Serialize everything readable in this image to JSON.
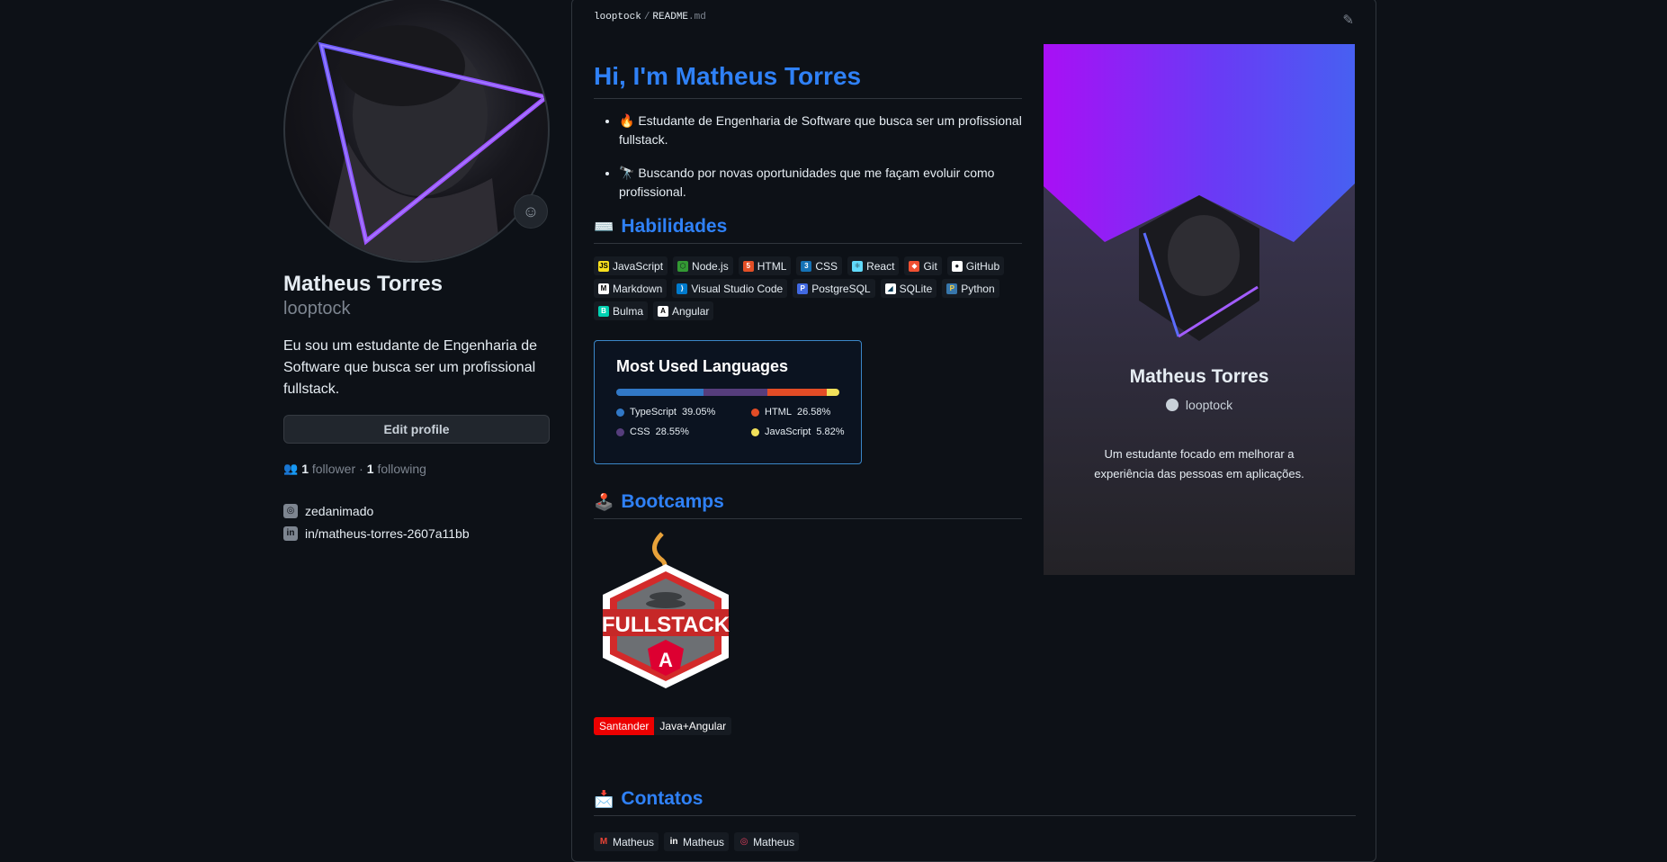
{
  "profile": {
    "name": "Matheus Torres",
    "login": "looptock",
    "bio": "Eu sou um estudante de Engenharia de Software que busca ser um profissional fullstack.",
    "edit_label": "Edit profile",
    "followers_count": "1",
    "followers_label": "follower",
    "dot": "·",
    "following_count": "1",
    "following_label": "following",
    "social": [
      {
        "icon": "instagram-icon",
        "text": "zedanimado"
      },
      {
        "icon": "linkedin-icon",
        "text": "in/matheus-torres-2607a11bb"
      }
    ]
  },
  "readme": {
    "breadcrumb_user": "looptock",
    "breadcrumb_sep": "/",
    "breadcrumb_file": "README",
    "breadcrumb_ext": ".md",
    "heading": "Hi, I'm Matheus Torres",
    "bullets": [
      {
        "emoji": "🔥",
        "text": "Estudante de Engenharia de Software que busca ser um profissional fullstack."
      },
      {
        "emoji": "🔭",
        "text": "Buscando por novas oportunidades que me façam evoluir como profissional."
      }
    ],
    "skills_emoji": "⌨️",
    "skills_title": "Habilidades",
    "skills": [
      {
        "label": "JavaScript",
        "icon": "javascript-icon",
        "color": "#f7df1e",
        "glyph": "JS",
        "fg": "#000"
      },
      {
        "label": "Node.js",
        "icon": "nodejs-icon",
        "color": "#339933",
        "glyph": "⬡",
        "fg": "#161b22"
      },
      {
        "label": "HTML",
        "icon": "html-icon",
        "color": "#e34f26",
        "glyph": "5",
        "fg": "#fff"
      },
      {
        "label": "CSS",
        "icon": "css-icon",
        "color": "#1572b6",
        "glyph": "3",
        "fg": "#fff"
      },
      {
        "label": "React",
        "icon": "react-icon",
        "color": "#61dafb",
        "glyph": "⚛",
        "fg": "#161b22"
      },
      {
        "label": "Git",
        "icon": "git-icon",
        "color": "#f05032",
        "glyph": "◆",
        "fg": "#fff"
      },
      {
        "label": "GitHub",
        "icon": "github-icon",
        "color": "#ffffff",
        "glyph": "●",
        "fg": "#161b22"
      },
      {
        "label": "Markdown",
        "icon": "markdown-icon",
        "color": "#ffffff",
        "glyph": "M",
        "fg": "#000"
      },
      {
        "label": "Visual Studio Code",
        "icon": "vscode-icon",
        "color": "#007acc",
        "glyph": "⟩",
        "fg": "#fff"
      },
      {
        "label": "PostgreSQL",
        "icon": "postgresql-icon",
        "color": "#4169e1",
        "glyph": "P",
        "fg": "#fff"
      },
      {
        "label": "SQLite",
        "icon": "sqlite-icon",
        "color": "#ffffff",
        "glyph": "◢",
        "fg": "#003b57"
      },
      {
        "label": "Python",
        "icon": "python-icon",
        "color": "#3776ab",
        "glyph": "P",
        "fg": "#ffd43b"
      },
      {
        "label": "Bulma",
        "icon": "bulma-icon",
        "color": "#00d1b2",
        "glyph": "B",
        "fg": "#fff"
      },
      {
        "label": "Angular",
        "icon": "angular-icon",
        "color": "#ffffff",
        "glyph": "A",
        "fg": "#000"
      }
    ],
    "languages": {
      "title": "Most Used Languages",
      "items": [
        {
          "name": "TypeScript",
          "pct": "39.05%",
          "value": 39.05,
          "color": "#3178c6"
        },
        {
          "name": "HTML",
          "pct": "26.58%",
          "value": 26.58,
          "color": "#e34c26"
        },
        {
          "name": "CSS",
          "pct": "28.55%",
          "value": 28.55,
          "color": "#563d7c"
        },
        {
          "name": "JavaScript",
          "pct": "5.82%",
          "value": 5.82,
          "color": "#f1e05a"
        }
      ]
    },
    "bootcamps_emoji": "🕹️",
    "bootcamps_title": "Bootcamps",
    "java_badge_text": "FULLSTACK",
    "java_badge_letter": "A",
    "santander_label": "Santander",
    "santander_value": "Java+Angular",
    "contacts_emoji": "📩",
    "contacts_title": "Contatos",
    "contacts": [
      {
        "label": "Matheus",
        "icon": "gmail-icon",
        "color": "#ea4335",
        "glyph": "M"
      },
      {
        "label": "Matheus",
        "icon": "linkedin-icon",
        "color": "#ffffff",
        "glyph": "in"
      },
      {
        "label": "Matheus",
        "icon": "instagram-icon",
        "color": "#e4405f",
        "glyph": "◎"
      }
    ]
  },
  "card": {
    "name": "Matheus Torres",
    "login": "looptock",
    "description": "Um estudante focado em melhorar a experiência das pessoas em aplicações."
  }
}
